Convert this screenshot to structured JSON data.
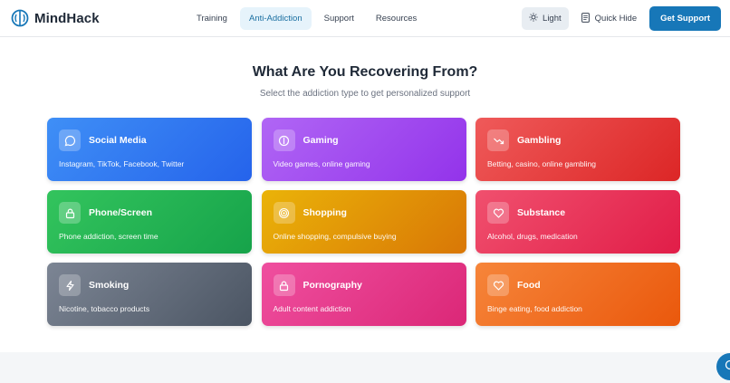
{
  "header": {
    "brand": "MindHack",
    "nav": [
      {
        "label": "Training",
        "active": false
      },
      {
        "label": "Anti-Addiction",
        "active": true
      },
      {
        "label": "Support",
        "active": false
      },
      {
        "label": "Resources",
        "active": false
      }
    ],
    "theme_label": "Light",
    "quick_hide_label": "Quick Hide",
    "cta_label": "Get Support"
  },
  "main": {
    "title": "What Are You Recovering From?",
    "subtitle": "Select the addiction type to get personalized support",
    "cards": [
      {
        "title": "Social Media",
        "desc": "Instagram, TikTok, Facebook, Twitter",
        "icon": "chat-bubble-icon",
        "color_from": "#3f8ff6",
        "color_to": "#2563eb"
      },
      {
        "title": "Gaming",
        "desc": "Video games, online gaming",
        "icon": "gaming-icon",
        "color_from": "#b066f5",
        "color_to": "#9333ea"
      },
      {
        "title": "Gambling",
        "desc": "Betting, casino, online gambling",
        "icon": "trending-down-icon",
        "color_from": "#ef5a5a",
        "color_to": "#dc2626"
      },
      {
        "title": "Phone/Screen",
        "desc": "Phone addiction, screen time",
        "icon": "lock-icon",
        "color_from": "#33c45d",
        "color_to": "#16a34a"
      },
      {
        "title": "Shopping",
        "desc": "Online shopping, compulsive buying",
        "icon": "target-icon",
        "color_from": "#eab308",
        "color_to": "#d97706"
      },
      {
        "title": "Substance",
        "desc": "Alcohol, drugs, medication",
        "icon": "heart-icon",
        "color_from": "#f0506e",
        "color_to": "#e11d48"
      },
      {
        "title": "Smoking",
        "desc": "Nicotine, tobacco products",
        "icon": "lightning-icon",
        "color_from": "#7c8594",
        "color_to": "#4b5563"
      },
      {
        "title": "Pornography",
        "desc": "Adult content addiction",
        "icon": "lock-icon",
        "color_from": "#ef4f9f",
        "color_to": "#db2777"
      },
      {
        "title": "Food",
        "desc": "Binge eating, food addiction",
        "icon": "heart-icon",
        "color_from": "#f6853a",
        "color_to": "#ea580c"
      }
    ]
  }
}
